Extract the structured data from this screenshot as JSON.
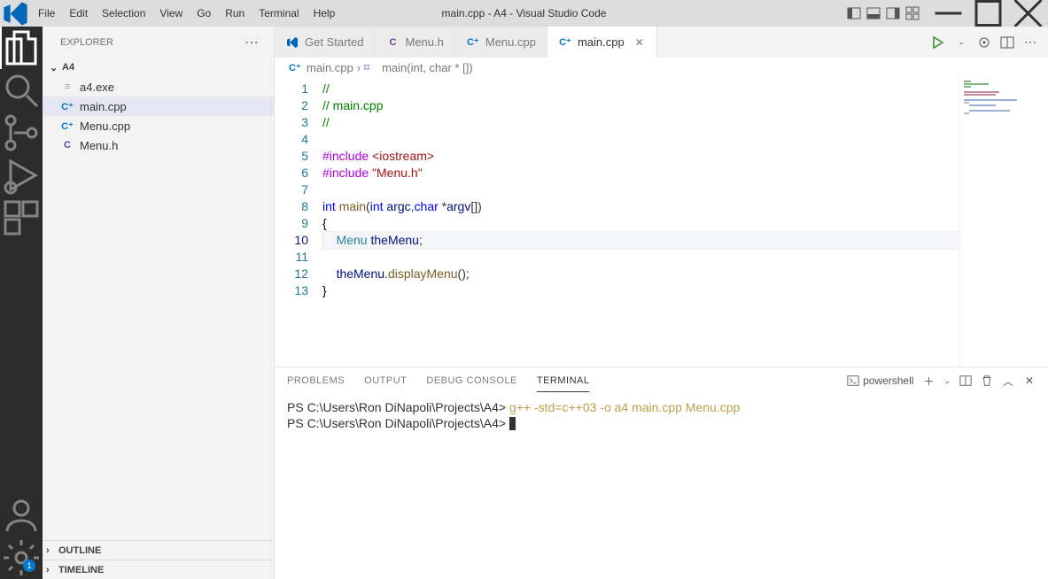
{
  "window": {
    "title": "main.cpp - A4 - Visual Studio Code"
  },
  "menubar": [
    "File",
    "Edit",
    "Selection",
    "View",
    "Go",
    "Run",
    "Terminal",
    "Help"
  ],
  "activitybar": {
    "settings_badge": "1"
  },
  "sidebar": {
    "title": "EXPLORER",
    "folder": "A4",
    "files": [
      {
        "name": "a4.exe",
        "icon": "≡",
        "cls": "exe"
      },
      {
        "name": "main.cpp",
        "icon": "C⁺",
        "cls": "cpp"
      },
      {
        "name": "Menu.cpp",
        "icon": "C⁺",
        "cls": "cpp"
      },
      {
        "name": "Menu.h",
        "icon": "C",
        "cls": "h"
      }
    ],
    "sections": [
      "OUTLINE",
      "TIMELINE"
    ]
  },
  "tabs": [
    {
      "label": "Get Started",
      "icon": "vs"
    },
    {
      "label": "Menu.h",
      "icon": "h"
    },
    {
      "label": "Menu.cpp",
      "icon": "cpp"
    },
    {
      "label": "main.cpp",
      "icon": "cpp",
      "active": true
    }
  ],
  "breadcrumbs": {
    "file": "main.cpp",
    "func": "main(int, char * [])"
  },
  "editor": {
    "current_line": 10,
    "lines": [
      {
        "n": 1,
        "html": "<span class='tok-comment'>//</span>"
      },
      {
        "n": 2,
        "html": "<span class='tok-comment'>// main.cpp</span>"
      },
      {
        "n": 3,
        "html": "<span class='tok-comment'>//</span>"
      },
      {
        "n": 4,
        "html": ""
      },
      {
        "n": 5,
        "html": "<span class='tok-include'>#include</span> <span class='tok-string'>&lt;iostream&gt;</span>"
      },
      {
        "n": 6,
        "html": "<span class='tok-include'>#include</span> <span class='tok-string'>\"Menu.h\"</span>"
      },
      {
        "n": 7,
        "html": ""
      },
      {
        "n": 8,
        "html": "<span class='tok-keyword'>int</span> <span class='tok-func'>main</span>(<span class='tok-keyword'>int</span> <span class='tok-var'>argc</span>,<span class='tok-keyword'>char</span> *<span class='tok-var'>argv</span>[])"
      },
      {
        "n": 9,
        "html": "<span class='tok-plain'>{</span>"
      },
      {
        "n": 10,
        "html": "    <span class='tok-type'>Menu</span> <span class='tok-var'>theMenu</span>;"
      },
      {
        "n": 11,
        "html": ""
      },
      {
        "n": 12,
        "html": "    <span class='tok-var'>theMenu</span>.<span class='tok-func'>displayMenu</span>();"
      },
      {
        "n": 13,
        "html": "<span class='tok-plain'>}</span>"
      }
    ]
  },
  "panel": {
    "tabs": [
      "PROBLEMS",
      "OUTPUT",
      "DEBUG CONSOLE",
      "TERMINAL"
    ],
    "active_tab": "TERMINAL",
    "shell": "powershell",
    "terminal": {
      "prompt": "PS C:\\Users\\Ron DiNapoli\\Projects\\A4>",
      "cmd": "g++ -std=c++03 -o a4 main.cpp Menu.cpp"
    }
  }
}
